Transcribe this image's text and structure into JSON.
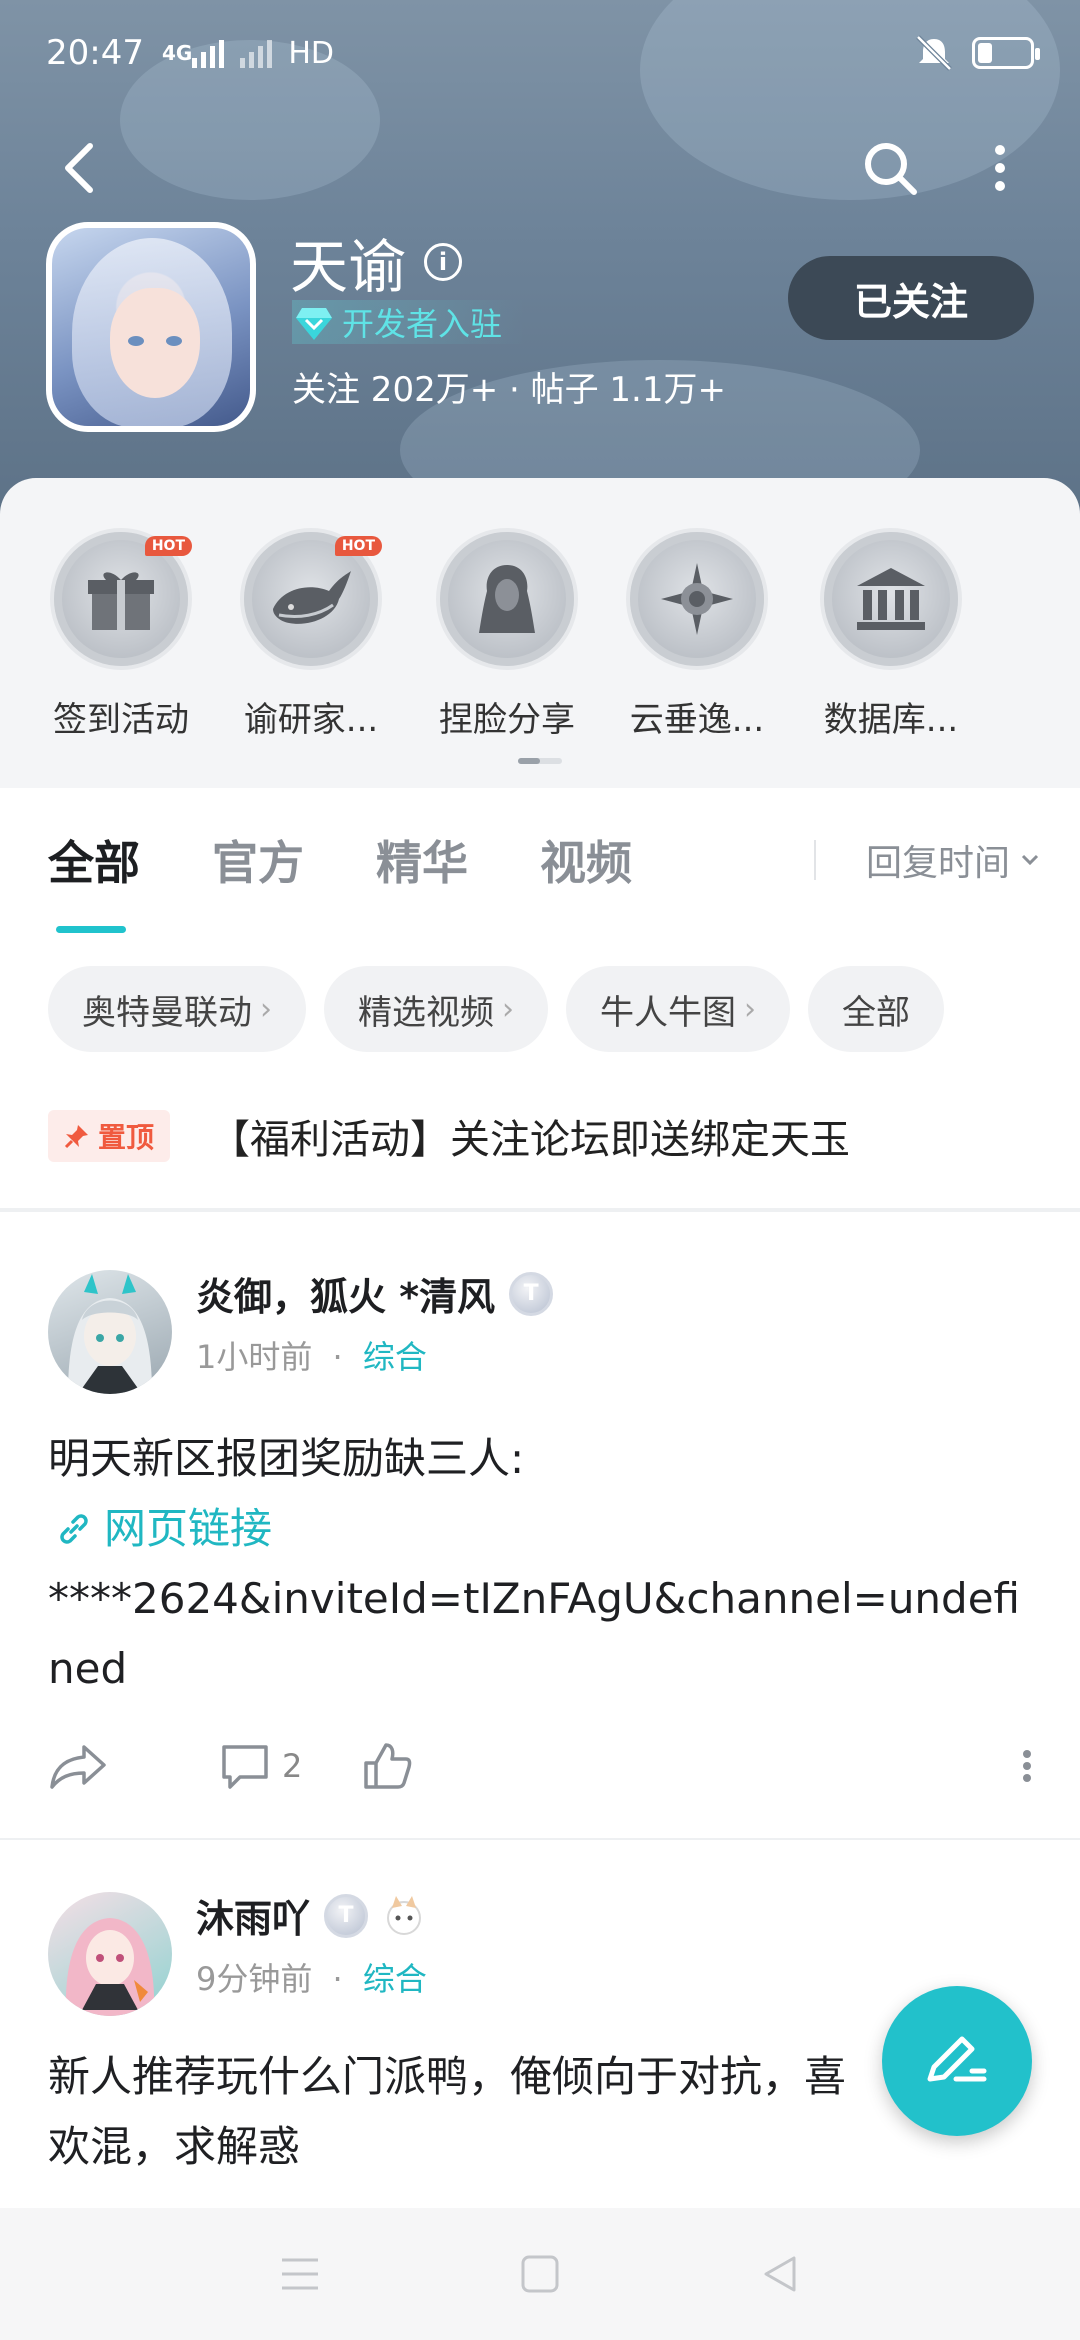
{
  "status_bar": {
    "time": "20:47",
    "network": "4G",
    "hd": "HD"
  },
  "forum": {
    "name": "天谕",
    "dev_tag": "开发者入驻",
    "stats": "关注 202万+ · 帖子 1.1万+",
    "follow_label": "已关注"
  },
  "shortcuts": [
    {
      "label": "签到活动",
      "hot": "HOT",
      "icon": "gift-icon"
    },
    {
      "label": "谕研家...",
      "hot": "HOT",
      "icon": "whale-icon"
    },
    {
      "label": "捏脸分享",
      "hot": "",
      "icon": "face-silhouette-icon"
    },
    {
      "label": "云垂逸...",
      "hot": "",
      "icon": "compass-icon"
    },
    {
      "label": "数据库...",
      "hot": "",
      "icon": "bank-icon"
    }
  ],
  "tabs": [
    "全部",
    "官方",
    "精华",
    "视频"
  ],
  "sort_label": "回复时间",
  "chips": [
    {
      "label": "奥特曼联动",
      "arrow": "›"
    },
    {
      "label": "精选视频",
      "arrow": "›"
    },
    {
      "label": "牛人牛图",
      "arrow": "›"
    },
    {
      "label": "全部",
      "arrow": ""
    }
  ],
  "pinned": {
    "tag": "置顶",
    "title": "【福利活动】关注论坛即送绑定天玉"
  },
  "posts": [
    {
      "author": "炎御，狐火 *清风",
      "badge": "T",
      "time": "1小时前",
      "dot": "·",
      "category": "综合",
      "text": "明天新区报团奖励缺三人:",
      "link": "网页链接",
      "url_text": "****2624&inviteId=tIZnFAgU&channel=undefined",
      "comments": "2"
    },
    {
      "author": "沐雨吖",
      "badge": "T",
      "time": "9分钟前",
      "dot": "·",
      "category": "综合",
      "text": "新人推荐玩什么门派鸭，俺倾向于对抗，喜欢混，求解惑"
    }
  ],
  "colors": {
    "accent": "#20c3cd",
    "pin": "#f05a3f",
    "header": "#6d8399"
  }
}
